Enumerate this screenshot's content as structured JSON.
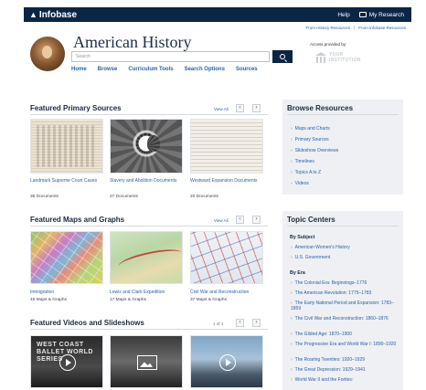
{
  "topbar": {
    "logo": "Infobase",
    "help": "Help",
    "my_research": "My Research"
  },
  "util_links": [
    "From History Resources",
    "From Infobase Resources"
  ],
  "header": {
    "title": "American History",
    "search_placeholder": "Search",
    "access_label": "Access provided by:",
    "institution_line1": "YOUR",
    "institution_line2": "INSTITUTION"
  },
  "nav": [
    "Home",
    "Browse",
    "Curriculum Tools",
    "Search Options",
    "Sources"
  ],
  "primary_sources": {
    "title": "Featured Primary Sources",
    "view_all": "View All",
    "cards": [
      {
        "title": "Landmark Supreme Court Cases",
        "count": "36 Documents"
      },
      {
        "title": "Slavery and Abolition Documents",
        "count": "27 Documents"
      },
      {
        "title": "Westward Expansion Documents",
        "count": "20 Documents"
      }
    ]
  },
  "maps": {
    "title": "Featured Maps and Graphs",
    "view_all": "View All",
    "cards": [
      {
        "title": "Immigration",
        "count": "45 Maps & Graphs"
      },
      {
        "title": "Lewis and Clark Expedition",
        "count": "17 Maps & Graphs"
      },
      {
        "title": "Civil War and Reconstruction",
        "count": "37 Maps & Graphs"
      }
    ]
  },
  "videos": {
    "title": "Featured Videos and Slideshows",
    "pager": "1 of 4",
    "card1_text": "WEST COAST BALLET WORLD SERIES"
  },
  "browse": {
    "title": "Browse Resources",
    "links": [
      "Maps and Charts",
      "Primary Sources",
      "Slideshow Overviews",
      "Timelines",
      "Topics A to Z",
      "Videos"
    ]
  },
  "topic_centers": {
    "title": "Topic Centers",
    "by_subject": "By Subject",
    "subjects": [
      "American Women's History",
      "U.S. Government"
    ],
    "by_era": "By Era",
    "eras": [
      "The Colonial Era: Beginnings–1776",
      "The American Revolution: 1775–1783",
      "The Early National Period and Expansion: 1783–1859",
      "The Civil War and Reconstruction: 1860–1876",
      "The Gilded Age: 1870–1900",
      "The Progressive Era and World War I: 1890–1920",
      "The Roaring Twenties: 1920–1929",
      "The Great Depression: 1929–1941",
      "World War II and the Forties:"
    ]
  },
  "colors": {
    "navy": "#0b2545",
    "link": "#2a5fa8",
    "panel": "#eef0f3"
  }
}
